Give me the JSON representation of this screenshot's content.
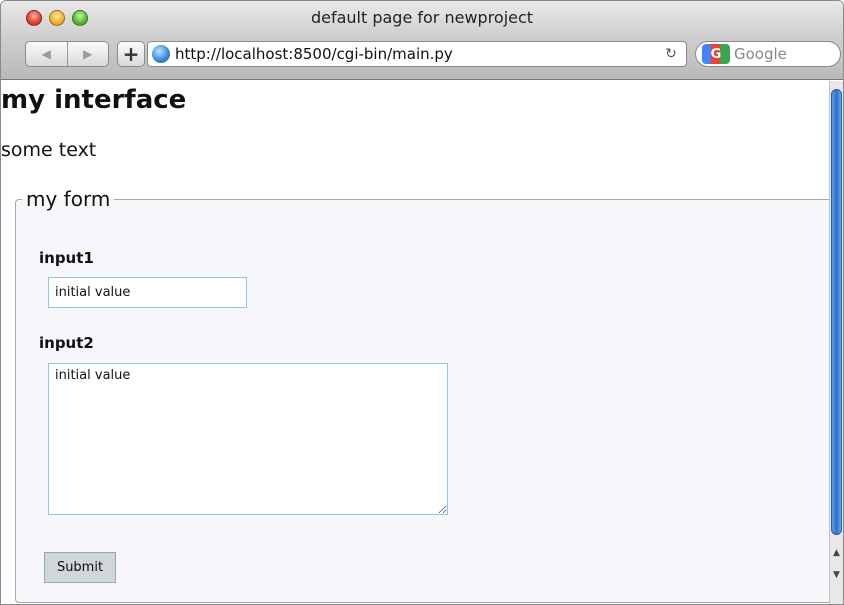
{
  "window": {
    "title": "default page for newproject"
  },
  "toolbar": {
    "back_icon": "back-arrow-icon",
    "forward_icon": "forward-arrow-icon",
    "add_icon": "plus-icon",
    "add_label": "+",
    "url": "http://localhost:8500/cgi-bin/main.py",
    "reload_icon": "reload-icon",
    "search_placeholder": "Google"
  },
  "page": {
    "heading": "my interface",
    "paragraph": "some text",
    "form": {
      "legend": "my form",
      "field1": {
        "label": "input1",
        "value": "initial value"
      },
      "field2": {
        "label": "input2",
        "value": "initial value"
      },
      "submit_label": "Submit"
    }
  },
  "colors": {
    "input_border": "#8fc6e6",
    "scroll_thumb": "#2d6fd0"
  }
}
